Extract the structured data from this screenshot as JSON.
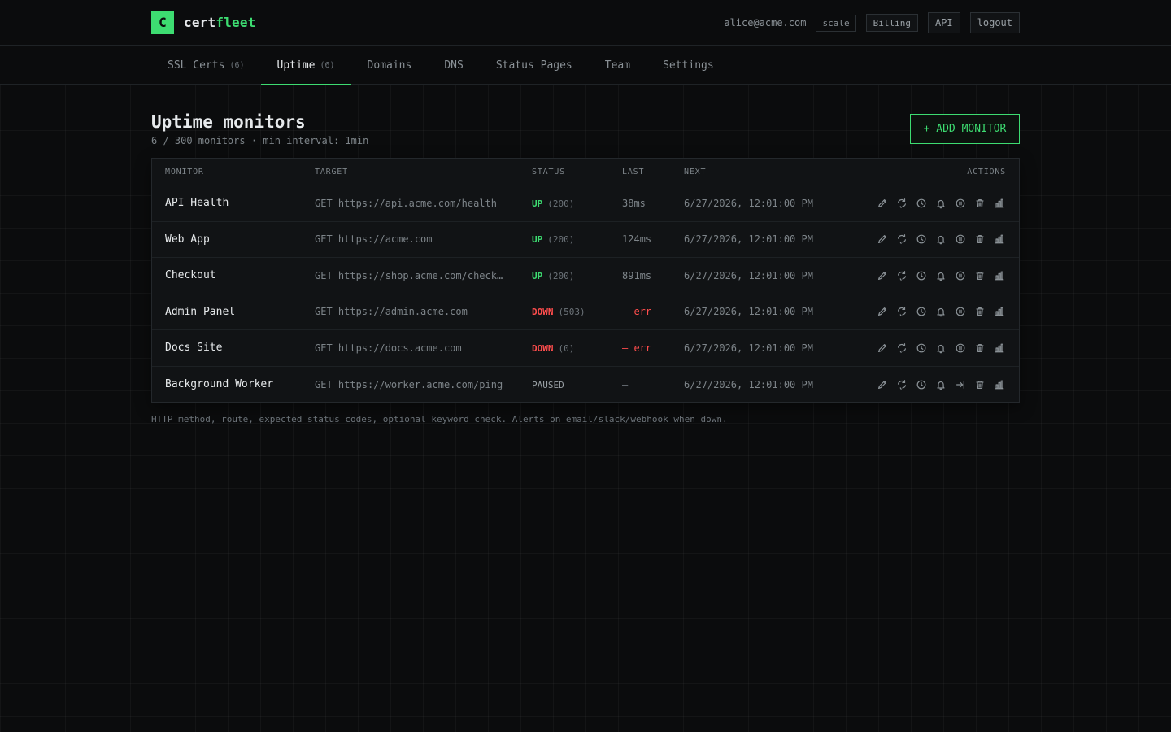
{
  "app": {
    "name_prefix": "cert",
    "name_suffix": "fleet",
    "logo_letter": "C"
  },
  "header": {
    "user_email": "alice@acme.com",
    "plan": "scale",
    "billing_label": "Billing",
    "api_label": "API",
    "logout_label": "logout"
  },
  "tabs": [
    {
      "label": "SSL Certs",
      "count": "(6)"
    },
    {
      "label": "Uptime",
      "count": "(6)"
    },
    {
      "label": "Domains",
      "count": ""
    },
    {
      "label": "DNS",
      "count": ""
    },
    {
      "label": "Status Pages",
      "count": ""
    },
    {
      "label": "Team",
      "count": ""
    },
    {
      "label": "Settings",
      "count": ""
    }
  ],
  "page": {
    "title": "Uptime monitors",
    "subtitle": "6 / 300 monitors · min interval: 1min",
    "add_button": "+ ADD MONITOR"
  },
  "table": {
    "columns": {
      "monitor": "MONITOR",
      "target": "TARGET",
      "status": "STATUS",
      "last": "LAST",
      "next": "NEXT",
      "actions": "ACTIONS"
    },
    "rows": [
      {
        "name": "API Health",
        "target": "GET https://api.acme.com/health",
        "status": "UP",
        "code": "(200)",
        "last": "38ms",
        "next": "6/27/2026, 12:01:00 PM"
      },
      {
        "name": "Web App",
        "target": "GET https://acme.com",
        "status": "UP",
        "code": "(200)",
        "last": "124ms",
        "next": "6/27/2026, 12:01:00 PM"
      },
      {
        "name": "Checkout",
        "target": "GET https://shop.acme.com/check…",
        "status": "UP",
        "code": "(200)",
        "last": "891ms",
        "next": "6/27/2026, 12:01:00 PM"
      },
      {
        "name": "Admin Panel",
        "target": "GET https://admin.acme.com",
        "status": "DOWN",
        "code": "(503)",
        "last": "— err",
        "next": "6/27/2026, 12:01:00 PM"
      },
      {
        "name": "Docs Site",
        "target": "GET https://docs.acme.com",
        "status": "DOWN",
        "code": "(0)",
        "last": "— err",
        "next": "6/27/2026, 12:01:00 PM"
      },
      {
        "name": "Background Worker",
        "target": "GET https://worker.acme.com/ping",
        "status": "PAUSED",
        "code": "",
        "last": "—",
        "next": "6/27/2026, 12:01:00 PM"
      }
    ]
  },
  "actions_icons": [
    "pencil-icon",
    "refresh-icon",
    "clock-icon",
    "bell-icon",
    "pause-icon",
    "trash-icon",
    "bar-chart-icon"
  ],
  "footnote": "HTTP method, route, expected status codes, optional keyword check. Alerts on email/slack/webhook when down.",
  "colors": {
    "accent": "#3ddc71",
    "down": "#ff4d4d",
    "background": "#0b0c0d",
    "panel": "#111315"
  }
}
